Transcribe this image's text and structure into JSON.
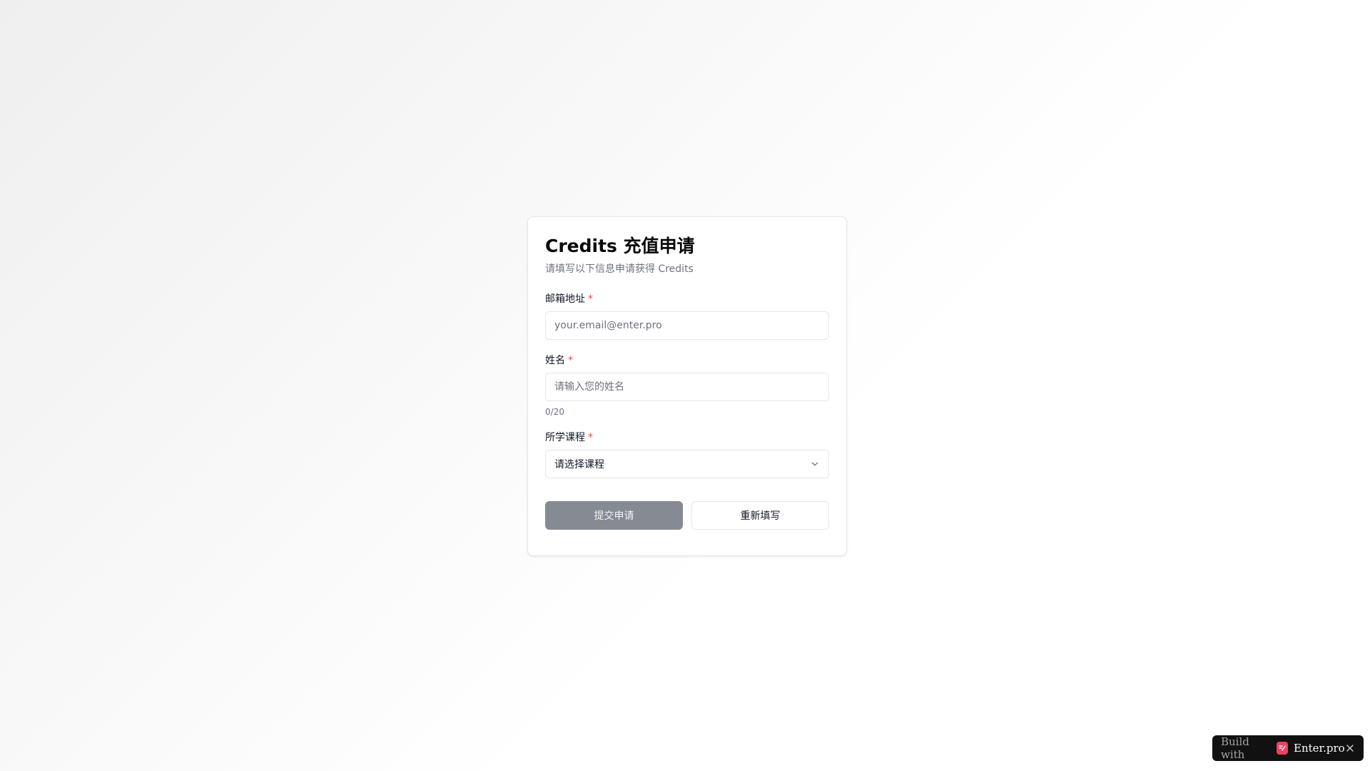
{
  "form": {
    "title": "Credits 充值申请",
    "subtitle": "请填写以下信息申请获得 Credits",
    "email": {
      "label": "邮箱地址",
      "required_mark": "*",
      "placeholder": "your.email@enter.pro",
      "value": ""
    },
    "name": {
      "label": "姓名",
      "required_mark": "*",
      "placeholder": "请输入您的姓名",
      "value": "",
      "counter": "0/20"
    },
    "course": {
      "label": "所学课程",
      "required_mark": "*",
      "selected": "请选择课程"
    },
    "submit_label": "提交申请",
    "reset_label": "重新填写"
  },
  "badge": {
    "prefix": "Build with",
    "brand": "Enter.pro",
    "logo_color": "#ef4060"
  },
  "colors": {
    "required": "#ef4444",
    "submit_disabled": "#868a93",
    "muted_text": "#6b7280"
  }
}
